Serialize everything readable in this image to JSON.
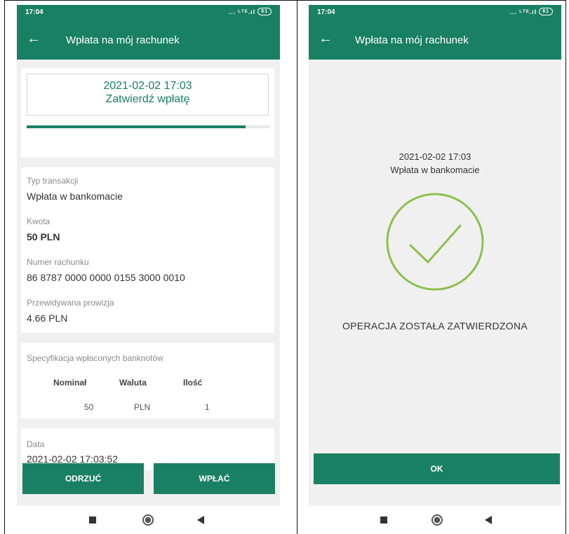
{
  "colors": {
    "brand_green": "#1a8063",
    "success_green": "#8cc04b"
  },
  "screen1": {
    "status": {
      "time": "17:04",
      "signal": "... ᴸᵀᴱ.ıl",
      "battery": "81"
    },
    "header": {
      "back_icon": "arrow-left-icon",
      "title": "Wpłata na mój rachunek"
    },
    "confirm": {
      "date": "2021-02-02 17:03",
      "action": "Zatwierdź wpłatę",
      "progress_fraction": 0.9
    },
    "details": [
      {
        "label": "Typ transakcji",
        "value": "Wpłata w bankomacie",
        "bold": false
      },
      {
        "label": "Kwota",
        "value": "50 PLN",
        "bold": true
      },
      {
        "label": "Numer rachunku",
        "value": "86 8787 0000 0000 0155 3000 0010",
        "bold": false
      },
      {
        "label": "Przewidywana prowizja",
        "value": "4.66 PLN",
        "bold": false
      }
    ],
    "spec": {
      "title": "Specyfikacja wpłaconych banknotów",
      "headers": [
        "Nominał",
        "Waluta",
        "Ilość"
      ],
      "rows": [
        [
          "50",
          "PLN",
          "1"
        ]
      ]
    },
    "date_field": {
      "label": "Data",
      "value": "2021-02-02 17:03:52"
    },
    "buttons": {
      "reject": "ODRZUĆ",
      "deposit": "WPŁAĆ"
    }
  },
  "screen2": {
    "status": {
      "time": "17:04",
      "signal": "... ᴸᵀᴱ.ıl",
      "battery": "81"
    },
    "header": {
      "back_icon": "arrow-left-icon",
      "title": "Wpłata na mój rachunek"
    },
    "success": {
      "date": "2021-02-02 17:03",
      "subtitle": "Wpłata w bankomacie",
      "icon": "checkmark-circle-icon",
      "message": "OPERACJA ZOSTAŁA ZATWIERDZONA"
    },
    "ok_button": "OK"
  },
  "nav_icons": [
    "recent-apps-icon",
    "home-icon",
    "back-icon"
  ]
}
